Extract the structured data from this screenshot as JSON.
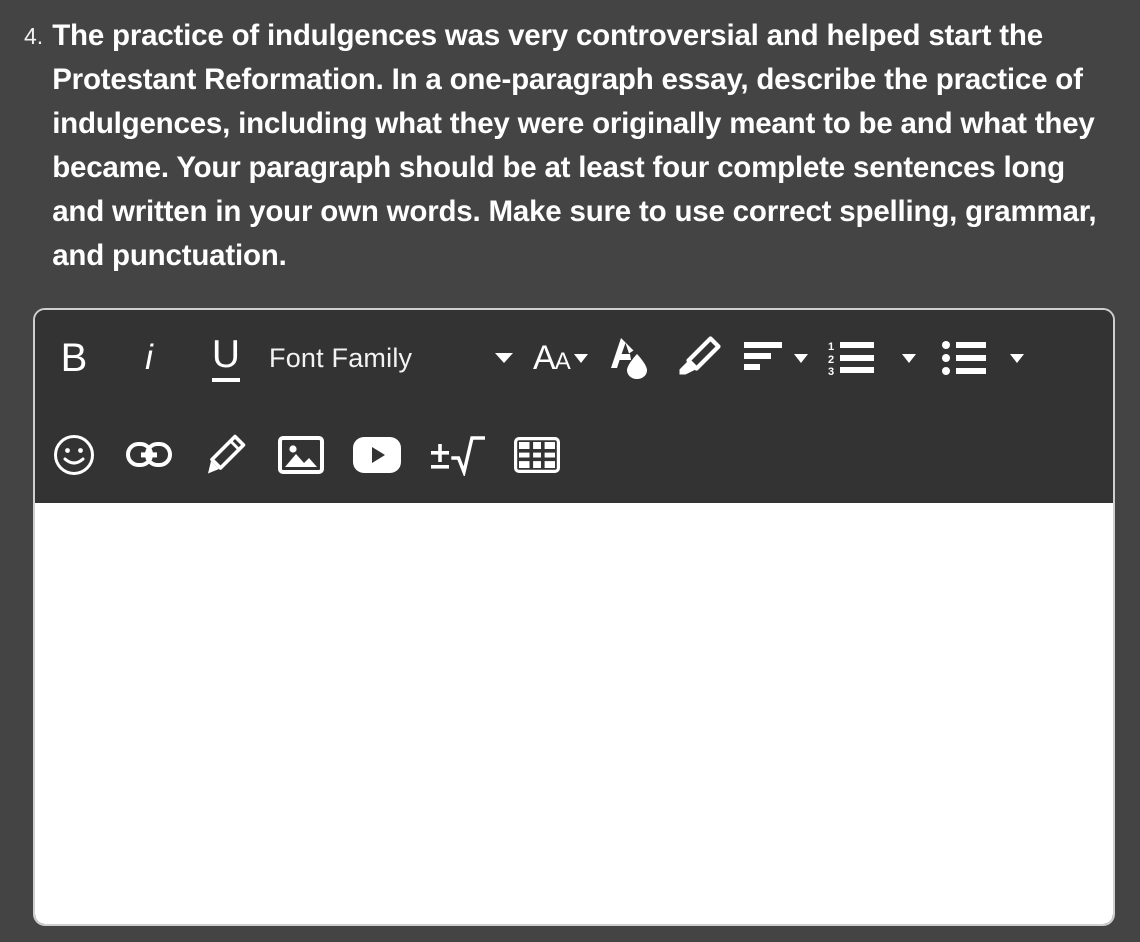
{
  "question": {
    "number": "4.",
    "text": "The practice of indulgences was very controversial and helped start the Protestant Reformation. In a one-paragraph essay, describe the practice of indulgences, including what they were originally meant to be and what they became. Your paragraph should be at least four complete sentences long and written in your own words. Make sure to use correct spelling, grammar, and punctuation."
  },
  "editor": {
    "toolbar": {
      "row1": {
        "bold_label": "B",
        "italic_label": "i",
        "underline_label": "U",
        "font_family_label": "Font Family",
        "font_size_large": "A",
        "font_size_small": "A",
        "text_color_name": "text-color",
        "highlight_name": "highlighter",
        "align_name": "text-align",
        "numbered_list_name": "numbered-list",
        "numbered_list_digits": [
          "1",
          "2",
          "3"
        ],
        "bulleted_list_name": "bulleted-list"
      },
      "row2": {
        "emoji_name": "emoji",
        "link_name": "insert-link",
        "draw_name": "draw",
        "image_name": "insert-image",
        "video_name": "insert-youtube-video",
        "math_label": "±√",
        "table_name": "insert-table"
      }
    },
    "content": {
      "value": "",
      "placeholder": ""
    }
  },
  "colors": {
    "page_background": "#444444",
    "toolbar_background": "#333333",
    "content_background": "#ffffff",
    "border": "#cfcfcf",
    "text": "#ffffff"
  }
}
